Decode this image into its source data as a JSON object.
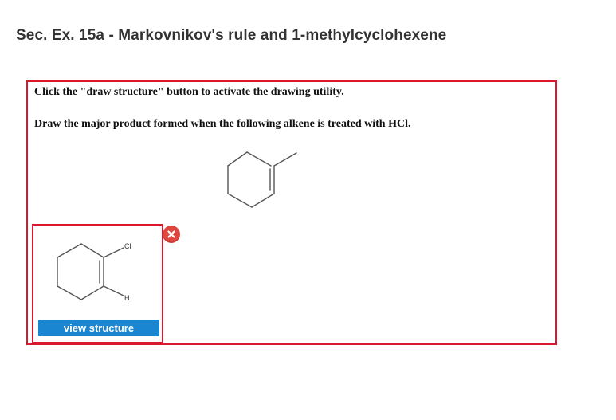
{
  "page": {
    "title": "Sec. Ex. 15a - Markovnikov's rule and 1-methylcyclohexene"
  },
  "question": {
    "instruction_1": "Click the \"draw structure\" button to activate the drawing utility.",
    "instruction_2": "Draw the major product formed when the following alkene is treated with HCl."
  },
  "answer": {
    "atom_labels": {
      "chlorine": "Cl",
      "hydrogen": "H"
    },
    "view_button_label": "view structure"
  },
  "icons": {
    "remove": "close-icon"
  },
  "colors": {
    "highlight_border": "#d9182b",
    "button_blue": "#1a86d2",
    "remove_red": "#e0463f",
    "bond_gray": "#555555"
  }
}
